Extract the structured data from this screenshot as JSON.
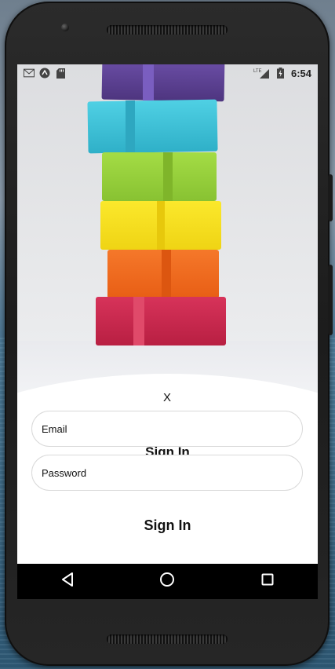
{
  "status_bar": {
    "left_icons": [
      "gmail-icon",
      "sync-icon",
      "sd-card-icon"
    ],
    "network_label": "LTE",
    "time": "6:54"
  },
  "close_button": {
    "label": "X"
  },
  "form": {
    "title": "Sign In",
    "email": {
      "placeholder": "Email",
      "value": ""
    },
    "password": {
      "placeholder": "Password",
      "value": ""
    },
    "submit_label": "Sign In"
  },
  "nav_bar": {
    "back_icon": "back-triangle-icon",
    "home_icon": "home-circle-icon",
    "recents_icon": "recents-square-icon"
  },
  "colors": {
    "screen_bg": "#ffffff",
    "field_border": "#d9d9d9",
    "navbar_bg": "#000000",
    "box_purple": "#5b3f94",
    "box_blue": "#3cc0d6",
    "box_green": "#97d13a",
    "box_yellow": "#f5e020",
    "box_orange": "#f06a1d",
    "box_red": "#c8264a"
  }
}
